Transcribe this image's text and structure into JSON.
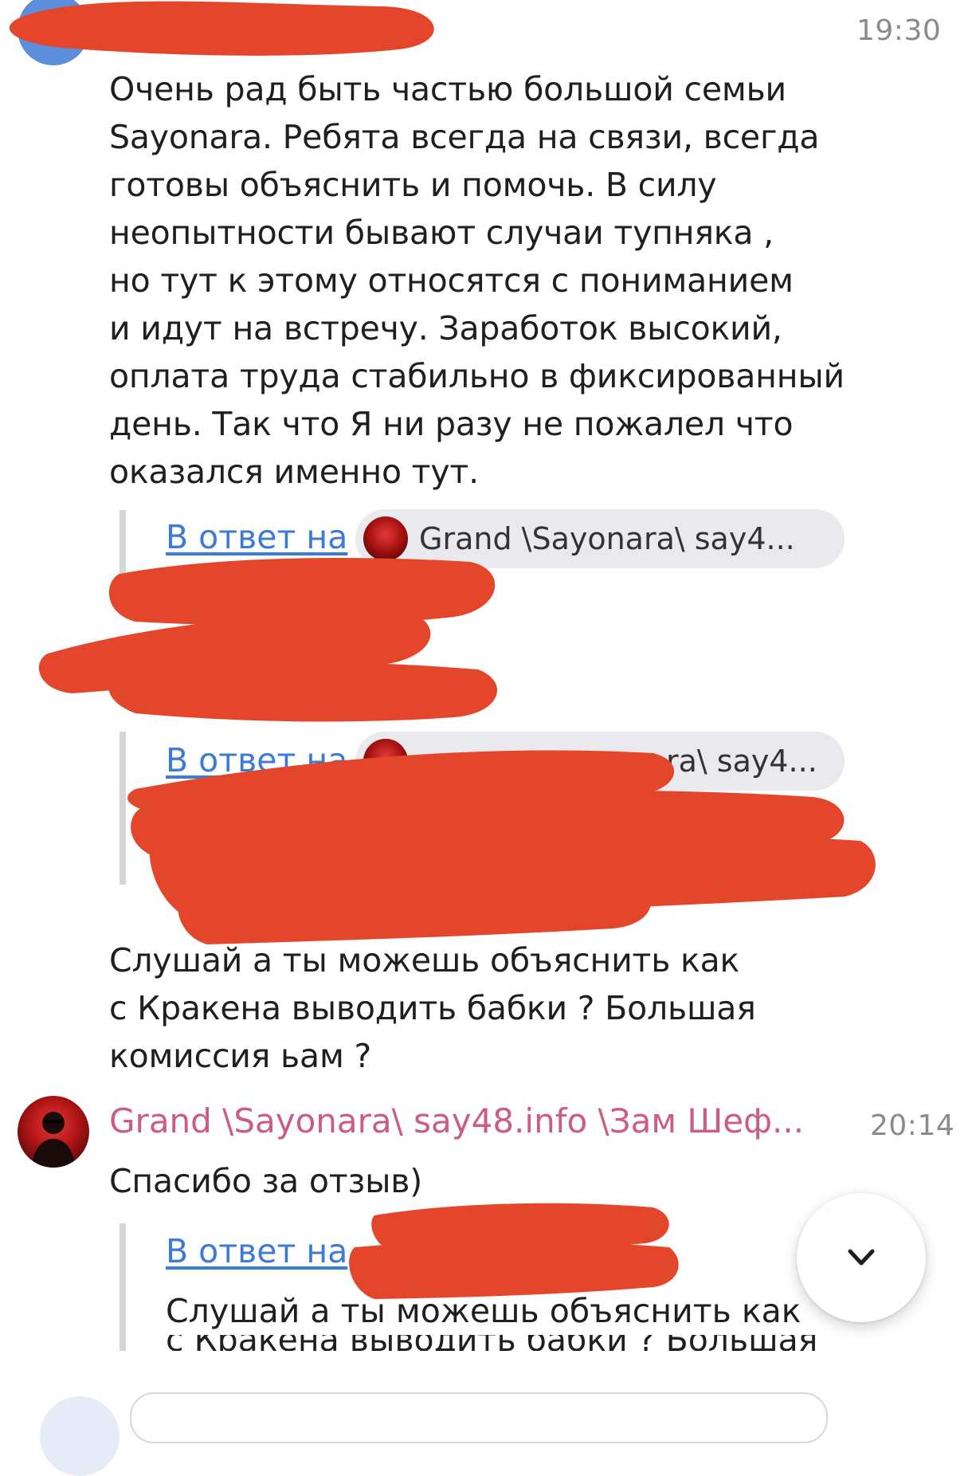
{
  "messages": [
    {
      "time": "19:30",
      "text": "Очень рад быть частью большой семьи\nSayonara.  Ребята всегда на связи, всегда\nготовы объяснить и помочь. В силу\nнеопытности бывают случаи тупняка ,\nно тут к этому относятся с пониманием\nи идут на встречу. Заработок высокий,\nоплата труда стабильно в фиксированный\nдень. Так что  Я ни разу не пожалел что\nоказался именно тут."
    }
  ],
  "replies": [
    {
      "link": "В ответ на",
      "chip": "Grand \\Sayonara\\ say4..."
    },
    {
      "link": "В ответ на",
      "chip": "ra\\ say4..."
    }
  ],
  "question": "Слушай а ты можешь объяснить как\nс Кракена выводить бабки ? Большая\nкомиссия ьам ?",
  "reply_message": {
    "sender": "Grand \\Sayonara\\ say48.info \\Зам Шеф...",
    "time": "20:14",
    "text": "Спасибо за отзыв)",
    "quote_link": "В ответ на",
    "quote_line1": "Слушай а ты можешь объяснить как",
    "quote_line2": "с Кракена выводить бабки ? Большая"
  },
  "colors": {
    "sender_name": "#cc5b85",
    "link": "#3d7ad6",
    "redaction": "#e4462b",
    "avatar_blue": "#5c8fdb"
  },
  "icons": {
    "scroll_down": "chevron-down-icon"
  }
}
